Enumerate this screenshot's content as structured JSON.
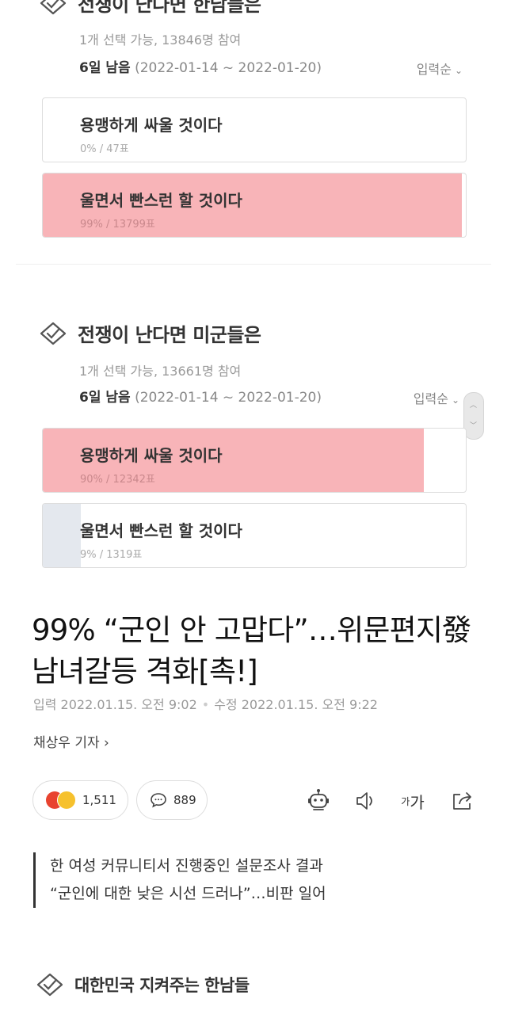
{
  "polls": [
    {
      "title": "전쟁이 난다면 한남들은",
      "meta": "1개 선택 가능, 13846명 참여",
      "remaining": "6일 남음",
      "period": "(2022-01-14 ~ 2022-01-20)",
      "sort_label": "입력순",
      "options": [
        {
          "label": "용맹하게 싸울 것이다",
          "stat": "0% / 47표",
          "percent": 0,
          "winner": false
        },
        {
          "label": "울면서 빤스런 할 것이다",
          "stat": "99% / 13799표",
          "percent": 99,
          "winner": true
        }
      ]
    },
    {
      "title": "전쟁이 난다면 미군들은",
      "meta": "1개 선택 가능, 13661명 참여",
      "remaining": "6일 남음",
      "period": "(2022-01-14 ~ 2022-01-20)",
      "sort_label": "입력순",
      "options": [
        {
          "label": "용맹하게 싸울 것이다",
          "stat": "90% / 12342표",
          "percent": 90,
          "winner": true
        },
        {
          "label": "울면서 빤스런 할 것이다",
          "stat": "9% / 1319표",
          "percent": 9,
          "winner": false
        }
      ]
    },
    {
      "title": "대한민국 지켜주는 한남들"
    }
  ],
  "article": {
    "headline_line1": "99% “군인 안 고맙다”…위문편지發",
    "headline_line2": "남녀갈등 격화[촉!]",
    "input_date": "입력 2022.01.15. 오전 9:02",
    "edit_date": "수정 2022.01.15. 오전 9:22",
    "reporter": "채상우 기자 ›",
    "reactions_count": "1,511",
    "comments_count": "889",
    "font_size_label_small": "가",
    "font_size_label_large": "가",
    "summary_line1": "한 여성 커뮤니티서 진행중인 설문조사 결과",
    "summary_line2": "“군인에 대한 낮은 시선 드러나”…비판 일어"
  },
  "colors": {
    "winner_fill": "#f8b4b8",
    "loser_fill": "#e4e8ee",
    "angry_emoji": "#e8432f",
    "smile_emoji": "#f6c12d"
  },
  "icons": [
    "check-vote-icon",
    "chevron-down-icon",
    "comment-icon",
    "robot-icon",
    "speaker-icon",
    "share-icon"
  ]
}
